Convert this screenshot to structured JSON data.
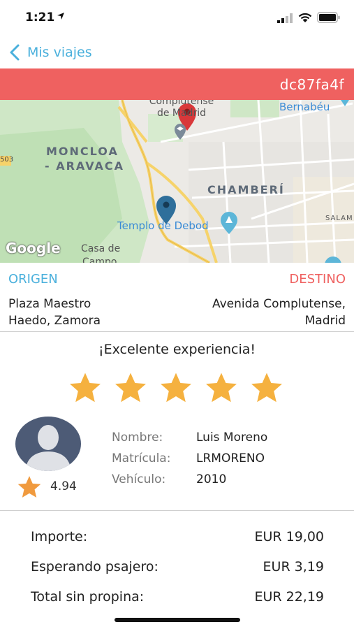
{
  "status_bar": {
    "time": "1:21"
  },
  "nav": {
    "back_label": "Mis viajes"
  },
  "trip": {
    "id": "dc87fa4f"
  },
  "map": {
    "labels": {
      "complutense": "Complutense de Madrid",
      "bernabeu": "Bernabéu",
      "moncloa_1": "MONCLOA",
      "moncloa_2": "- ARAVACA",
      "chamberi": "CHAMBERÍ",
      "templo": "Templo de Debod",
      "casa_de_campo_1": "Casa de",
      "casa_de_campo_2": "Campo",
      "salam": "SALAM",
      "road_503": "503"
    },
    "attribution": "Google",
    "colors": {
      "origin_pin": "#2f6f9b",
      "destination_pin": "#d9383a"
    }
  },
  "origin": {
    "label": "ORIGEN",
    "address_line1": "Plaza Maestro",
    "address_line2": "Haedo, Zamora"
  },
  "destination": {
    "label": "DESTINO",
    "address_line1": "Avenida Complutense,",
    "address_line2": "Madrid"
  },
  "rating": {
    "title": "¡Excelente experiencia!",
    "stars": 5,
    "max": 5,
    "star_color": "#f5b13f"
  },
  "driver": {
    "rating": "4.94",
    "fields": [
      {
        "label": "Nombre:",
        "value": "Luis Moreno"
      },
      {
        "label": "Matrícula:",
        "value": "LRMORENO"
      },
      {
        "label": "Vehículo:",
        "value": "2010"
      }
    ]
  },
  "prices": [
    {
      "label": "Importe:",
      "value": "EUR 19,00"
    },
    {
      "label": "Esperando psajero:",
      "value": "EUR 3,19"
    },
    {
      "label": "Total sin propina:",
      "value": "EUR 22,19"
    }
  ],
  "colors": {
    "accent_blue": "#4ab0dc",
    "accent_red": "#ef6160"
  }
}
